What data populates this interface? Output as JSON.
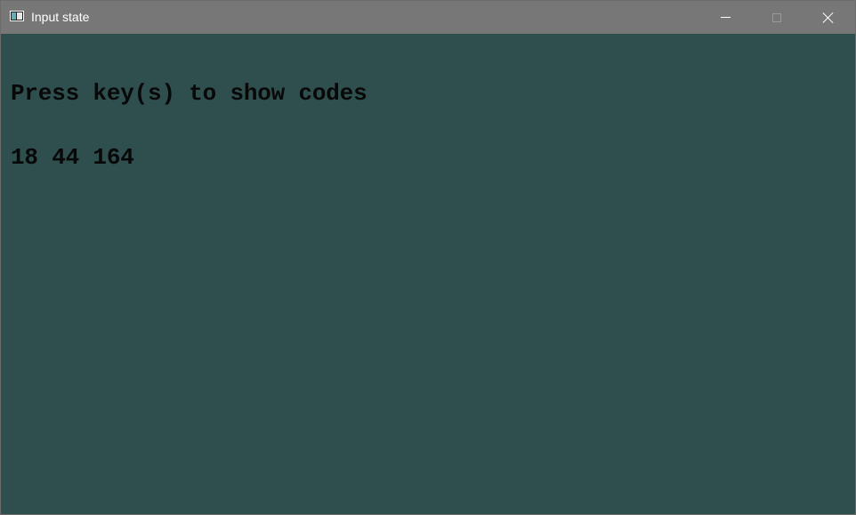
{
  "window": {
    "title": "Input state",
    "background_color": "#2f4f4f",
    "titlebar_color": "#777777",
    "icons": {
      "app": "console-window-icon",
      "minimize": "minimize-icon",
      "maximize": "maximize-icon",
      "close": "close-icon"
    }
  },
  "console": {
    "lines": [
      "Press key(s) to show codes",
      "18 44 164"
    ],
    "text_color": "#080808"
  }
}
